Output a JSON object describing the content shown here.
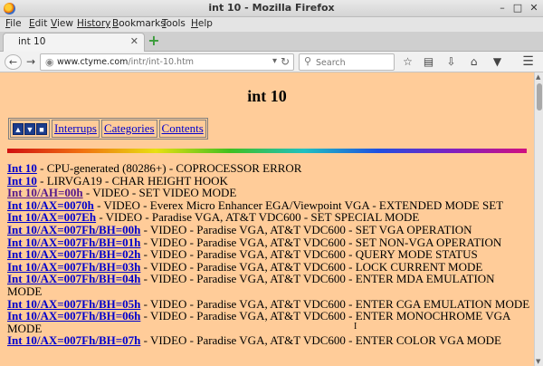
{
  "window": {
    "title": "int 10 - Mozilla Firefox",
    "minimize": "–",
    "maximize": "□",
    "close": "✕"
  },
  "menu": [
    {
      "ul": "F",
      "rest": "ile"
    },
    {
      "ul": "E",
      "rest": "dit"
    },
    {
      "ul": "V",
      "rest": "iew"
    },
    {
      "ul": "",
      "rest": "History"
    },
    {
      "ul": "B",
      "rest": "ookmarks"
    },
    {
      "ul": "T",
      "rest": "ools"
    },
    {
      "ul": "H",
      "rest": "elp"
    }
  ],
  "tab": {
    "label": "int 10",
    "close": "✕",
    "new_tab": "+"
  },
  "nav": {
    "back": "←",
    "forward": "→",
    "url_host": "www.ctyme.com",
    "url_path": "/intr/int-10.htm",
    "search_placeholder": "Search",
    "icons": [
      "bookmark-star-icon",
      "reading-list-icon",
      "downloads-icon",
      "home-icon",
      "pocket-icon",
      "menu-icon"
    ]
  },
  "page": {
    "title": "int 10",
    "nav_links": [
      "Interrups",
      "Categories",
      "Contents"
    ]
  },
  "entries": [
    {
      "link": "Int 10",
      "text": " - CPU-generated (80286+) - COPROCESSOR ERROR",
      "visited": false
    },
    {
      "link": "Int 10",
      "text": " - LIRVGA19 - CHAR HEIGHT HOOK",
      "visited": false
    },
    {
      "link": "Int 10/AH=00h",
      "text": " - VIDEO - SET VIDEO MODE",
      "visited": true
    },
    {
      "link": "Int 10/AX=0070h",
      "text": " - VIDEO - Everex Micro Enhancer EGA/Viewpoint VGA - EXTENDED MODE SET",
      "visited": false
    },
    {
      "link": "Int 10/AX=007Eh",
      "text": " - VIDEO - Paradise VGA, AT&T VDC600 - SET SPECIAL MODE",
      "visited": false
    },
    {
      "link": "Int 10/AX=007Fh/BH=00h",
      "text": " - VIDEO - Paradise VGA, AT&T VDC600 - SET VGA OPERATION",
      "visited": false
    },
    {
      "link": "Int 10/AX=007Fh/BH=01h",
      "text": " - VIDEO - Paradise VGA, AT&T VDC600 - SET NON-VGA OPERATION",
      "visited": false
    },
    {
      "link": "Int 10/AX=007Fh/BH=02h",
      "text": " - VIDEO - Paradise VGA, AT&T VDC600 - QUERY MODE STATUS",
      "visited": false
    },
    {
      "link": "Int 10/AX=007Fh/BH=03h",
      "text": " - VIDEO - Paradise VGA, AT&T VDC600 - LOCK CURRENT MODE",
      "visited": false
    },
    {
      "link": "Int 10/AX=007Fh/BH=04h",
      "text": " - VIDEO - Paradise VGA, AT&T VDC600 - ENTER MDA EMULATION MODE",
      "visited": false
    },
    {
      "link": "Int 10/AX=007Fh/BH=05h",
      "text": " - VIDEO - Paradise VGA, AT&T VDC600 - ENTER CGA EMULATION MODE",
      "visited": false
    },
    {
      "link": "Int 10/AX=007Fh/BH=06h",
      "text": " - VIDEO - Paradise VGA, AT&T VDC600 - ENTER MONOCHROME VGA MODE",
      "visited": false
    },
    {
      "link": "Int 10/AX=007Fh/BH=07h",
      "text": " - VIDEO - Paradise VGA, AT&T VDC600 - ENTER COLOR VGA MODE",
      "visited": false
    }
  ],
  "colors": {
    "page_bg": "#ffcc99",
    "link": "#0000cc",
    "visited": "#551a8b"
  }
}
